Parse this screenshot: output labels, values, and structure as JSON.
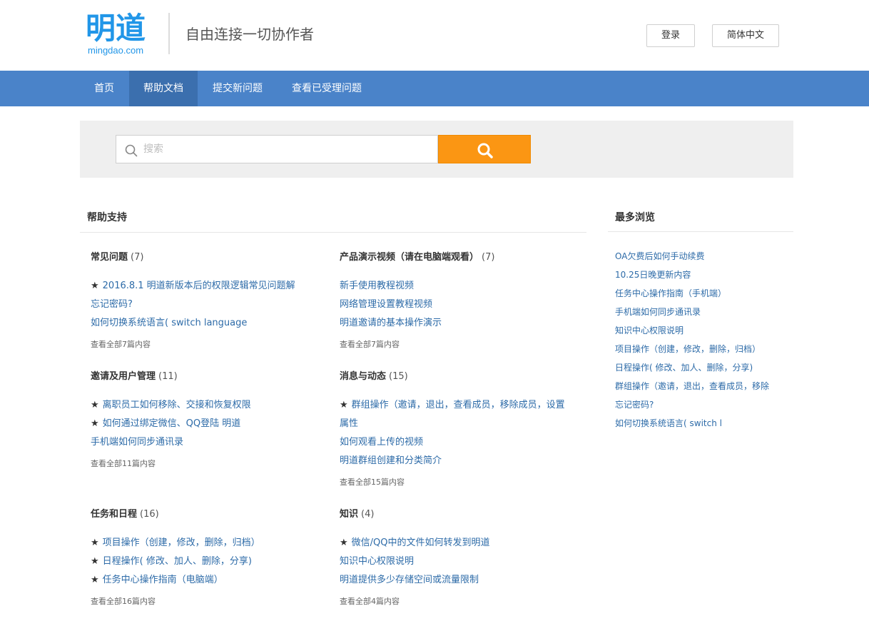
{
  "header": {
    "logo_text": "明道",
    "logo_domain": "mingdao.com",
    "slogan": "自由连接一切协作者",
    "login_label": "登录",
    "language_label": "简体中文"
  },
  "nav": {
    "items": [
      {
        "label": "首页"
      },
      {
        "label": "帮助文档",
        "active": true
      },
      {
        "label": "提交新问题"
      },
      {
        "label": "查看已受理问题"
      }
    ]
  },
  "search": {
    "placeholder": "搜索",
    "value": ""
  },
  "main": {
    "title": "帮助支持",
    "categories": [
      {
        "title": "常见问题",
        "count": "(7)",
        "links": [
          {
            "text": "2016.8.1 明道新版本后的权限逻辑常见问题解",
            "star": true
          },
          {
            "text": "忘记密码?",
            "star": false
          },
          {
            "text": "如何切换系统语言( switch language",
            "star": false
          }
        ],
        "more": "查看全部7篇内容"
      },
      {
        "title": "产品演示视频（请在电脑端观看）",
        "count": "(7)",
        "links": [
          {
            "text": "新手使用教程视频",
            "star": false
          },
          {
            "text": "网络管理设置教程视频",
            "star": false
          },
          {
            "text": "明道邀请的基本操作演示",
            "star": false
          }
        ],
        "more": "查看全部7篇内容"
      },
      {
        "title": "邀请及用户管理",
        "count": "(11)",
        "links": [
          {
            "text": "离职员工如何移除、交接和恢复权限",
            "star": true
          },
          {
            "text": "如何通过绑定微信、QQ登陆 明道",
            "star": true
          },
          {
            "text": "手机端如何同步通讯录",
            "star": false
          }
        ],
        "more": "查看全部11篇内容"
      },
      {
        "title": "消息与动态",
        "count": "(15)",
        "links": [
          {
            "text": "群组操作（邀请，退出，查看成员，移除成员，设置",
            "star": true
          },
          {
            "text": "属性",
            "star": false
          },
          {
            "text": "如何观看上传的视频",
            "star": false
          },
          {
            "text": "明道群组创建和分类简介",
            "star": false
          }
        ],
        "more": "查看全部15篇内容"
      },
      {
        "title": "任务和日程",
        "count": "(16)",
        "links": [
          {
            "text": "项目操作（创建，修改，删除，归档）",
            "star": true
          },
          {
            "text": "日程操作( 修改、加人、删除，分享)",
            "star": true
          },
          {
            "text": "任务中心操作指南（电脑端）",
            "star": true
          }
        ],
        "more": "查看全部16篇内容"
      },
      {
        "title": "知识",
        "count": "(4)",
        "links": [
          {
            "text": "微信/QQ中的文件如何转发到明道",
            "star": true
          },
          {
            "text": "知识中心权限说明",
            "star": false
          },
          {
            "text": "明道提供多少存储空间或流量限制",
            "star": false
          }
        ],
        "more": "查看全部4篇内容"
      }
    ]
  },
  "sidebar": {
    "title": "最多浏览",
    "links": [
      "OA欠费后如何手动续费",
      "10.25日晚更新内容",
      "任务中心操作指南（手机端）",
      "手机端如何同步通讯录",
      "知识中心权限说明",
      "项目操作（创建，修改，删除，归档）",
      "日程操作( 修改、加人、删除，分享)",
      "群组操作（邀请，退出，查看成员，移除",
      "忘记密码?",
      "如何切换系统语言( switch l"
    ]
  },
  "colors": {
    "nav_bg": "#4a83c9",
    "nav_active": "#3b6fae",
    "brand": "#2196e8",
    "search_button": "#fb9613",
    "link": "#2d6ba8"
  },
  "icons": {
    "search_field": "search-icon",
    "search_button": "search-icon"
  }
}
